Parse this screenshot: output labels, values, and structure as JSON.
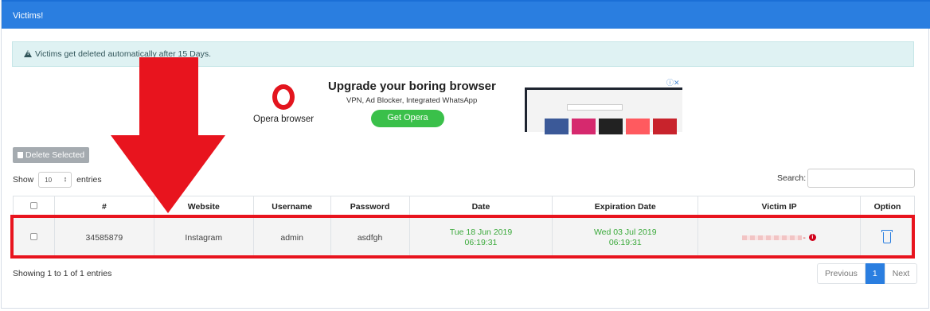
{
  "panel": {
    "title": "Victims!"
  },
  "alert": {
    "text": "Victims get deleted automatically after 15 Days."
  },
  "ad": {
    "brand": "Opera browser",
    "title": "Upgrade your boring browser",
    "subtitle": "VPN, Ad Blocker, Integrated WhatsApp",
    "button": "Get Opera"
  },
  "toolbar": {
    "delete_label": "Delete Selected"
  },
  "length": {
    "prefix": "Show",
    "value": "10",
    "suffix": "entries"
  },
  "search": {
    "label": "Search:",
    "value": ""
  },
  "table": {
    "headers": [
      "#",
      "Website",
      "Username",
      "Password",
      "Date",
      "Expiration Date",
      "Victim IP",
      "Option"
    ],
    "rows": [
      {
        "id": "34585879",
        "website": "Instagram",
        "username": "admin",
        "password": "asdfgh",
        "date_day": "Tue 18 Jun 2019",
        "date_time": "06:19:31",
        "exp_day": "Wed 03 Jul 2019",
        "exp_time": "06:19:31"
      }
    ]
  },
  "footer": {
    "info": "Showing 1 to 1 of 1 entries",
    "prev": "Previous",
    "page": "1",
    "next": "Next"
  },
  "colors": {
    "header": "#2a7ee0",
    "highlight": "#e8141e",
    "date_green": "#3aa93a"
  }
}
